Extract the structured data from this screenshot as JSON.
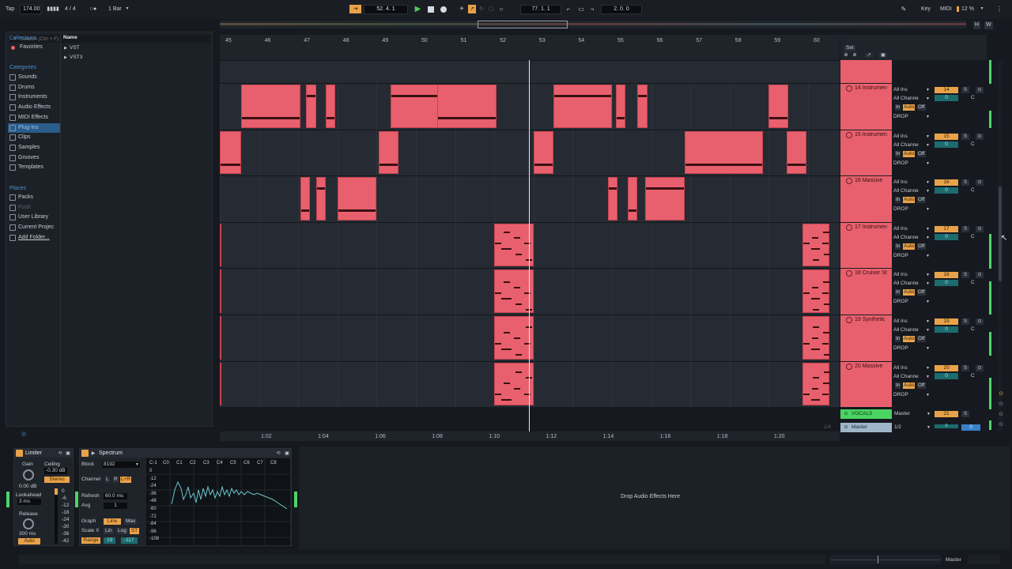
{
  "transport": {
    "tap": "Tap",
    "tempo": "174.00",
    "sig": "4 / 4",
    "quant": "1 Bar",
    "pos": "52.   4.   1",
    "loop_start": "77.   1.   1",
    "loop_len": "2.   0.   0",
    "key": "Key",
    "midi": "MIDI",
    "cpu": "12 %",
    "h": "H",
    "w": "W"
  },
  "browser": {
    "search_placeholder": "Search (Ctrl + F)",
    "collections_head": "Collections",
    "favorites": "Favorites",
    "categories_head": "Categories",
    "categories": [
      "Sounds",
      "Drums",
      "Instruments",
      "Audio Effects",
      "MIDI Effects",
      "Plug-Ins",
      "Clips",
      "Samples",
      "Grooves",
      "Templates"
    ],
    "places_head": "Places",
    "places": [
      "Packs",
      "Push",
      "User Library",
      "Current Projec",
      "Add Folder..."
    ],
    "name_col": "Name",
    "items": [
      "VST",
      "VST3"
    ]
  },
  "ruler": {
    "bars": [
      "45",
      "46",
      "47",
      "48",
      "49",
      "50",
      "51",
      "52",
      "53",
      "54",
      "55",
      "56",
      "57",
      "58",
      "59",
      "60"
    ],
    "times": [
      "1:02",
      "1:04",
      "1:06",
      "1:08",
      "1:10",
      "1:12",
      "1:14",
      "1:16",
      "1:18",
      "1:20"
    ],
    "set": "Set",
    "fraction": "1/4"
  },
  "tracks": [
    {
      "name": "14 Instrumen",
      "num": "14"
    },
    {
      "name": "15 Instrumen",
      "num": "15"
    },
    {
      "name": "16 Massive",
      "num": "16"
    },
    {
      "name": "17 Instrumen",
      "num": "17"
    },
    {
      "name": "18 Cruiser St",
      "num": "18"
    },
    {
      "name": "19 Synthetic",
      "num": "19"
    },
    {
      "name": "20 Massive",
      "num": "20"
    }
  ],
  "io": {
    "input": "All Ins",
    "channel": "All Channe",
    "in": "In",
    "auto": "Auto",
    "off": "Off",
    "out": "DROP"
  },
  "mixer": {
    "vol": "0",
    "pan": "C",
    "solo": "S"
  },
  "vocals": {
    "name": "VOCALS",
    "out": "Master",
    "num": "21",
    "solo": "S"
  },
  "master": {
    "name": "Master",
    "out": "1/2",
    "vol": "0",
    "vol2": "0"
  },
  "limiter": {
    "title": "Limiter",
    "gain": "Gain",
    "ceiling": "Ceiling",
    "ceiling_val": "-0.30 dB",
    "stereo": "Stereo",
    "gain_val": "0.00 dB",
    "lookahead": "Lookahead",
    "lookahead_val": "3 ms",
    "release": "Release",
    "release_val": "300 ms",
    "auto": "Auto",
    "scale": [
      "0",
      "-6",
      "-12",
      "-18",
      "-24",
      "-30",
      "-36",
      "-42"
    ]
  },
  "spectrum": {
    "title": "Spectrum",
    "block": "Block",
    "block_val": "8192",
    "channel": "Channel",
    "ch_l": "L",
    "ch_r": "R",
    "ch_lr": "L+R",
    "refresh": "Refresh",
    "refresh_val": "60.0 ms",
    "avg": "Avg",
    "avg_val": "1",
    "graph": "Graph",
    "line": "Line",
    "max": "Max",
    "scalex": "Scale X",
    "lin": "Lin",
    "log": "Log",
    "st": "ST",
    "range": "Range",
    "range_a": "19",
    "range_b": "-117",
    "notes": [
      "C-1",
      "C0",
      "C1",
      "C2",
      "C3",
      "C4",
      "C5",
      "C6",
      "C7",
      "C8"
    ],
    "db": [
      "0",
      "-12",
      "-24",
      "-36",
      "-48",
      "-60",
      "-72",
      "-84",
      "-96",
      "-108"
    ]
  },
  "drop_text": "Drop Audio Effects Here",
  "status": {
    "master": "Master"
  },
  "colors": {
    "clip": "#e8606d",
    "note": "#3a1014",
    "accent": "#e8a24a",
    "play": "#56c85a",
    "vocals": "#4bd363"
  }
}
